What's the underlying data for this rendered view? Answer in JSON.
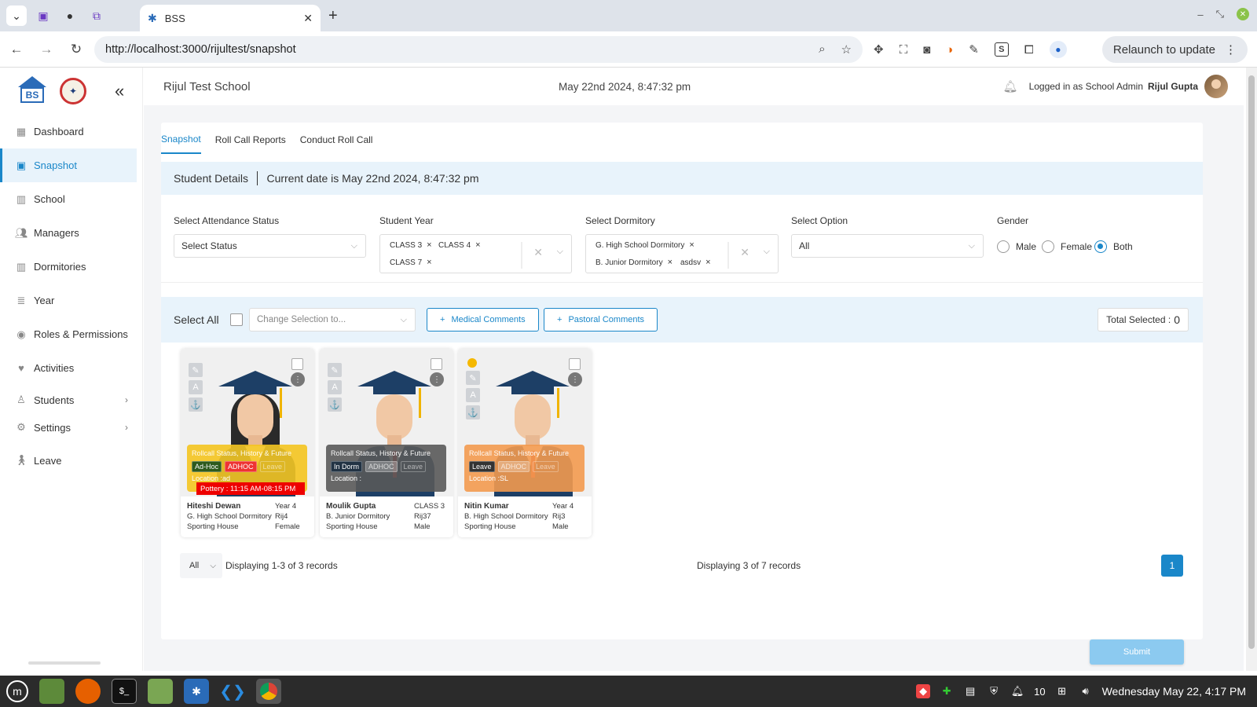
{
  "browser": {
    "tab_title": "BSS",
    "url": "http://localhost:3000/rijultest/snapshot",
    "relaunch_label": "Relaunch to update"
  },
  "sidebar": {
    "items": [
      {
        "label": "Dashboard",
        "icon": "dashboard-icon"
      },
      {
        "label": "Snapshot",
        "icon": "image-icon"
      },
      {
        "label": "School",
        "icon": "building-icon"
      },
      {
        "label": "Managers",
        "icon": "users-icon"
      },
      {
        "label": "Dormitories",
        "icon": "building-icon"
      },
      {
        "label": "Year",
        "icon": "user-list-icon"
      },
      {
        "label": "Roles & Permissions",
        "icon": "user-circle-icon"
      },
      {
        "label": "Activities",
        "icon": "heart-pulse-icon"
      },
      {
        "label": "Students",
        "icon": "user-icon"
      },
      {
        "label": "Settings",
        "icon": "gear-icon"
      },
      {
        "label": "Leave",
        "icon": "walking-icon"
      }
    ],
    "active": "Snapshot"
  },
  "header": {
    "school_name": "Rijul Test School",
    "datetime": "May 22nd 2024, 8:47:32 pm",
    "logged_in_prefix": "Logged in as School Admin",
    "user_name": "Rijul Gupta"
  },
  "tabs": [
    "Snapshot",
    "Roll Call Reports",
    "Conduct Roll Call"
  ],
  "details_bar": {
    "title": "Student Details",
    "current_date": "Current date is May 22nd 2024, 8:47:32 pm"
  },
  "filters": {
    "attendance_label": "Select Attendance Status",
    "attendance_value": "Select Status",
    "year_label": "Student Year",
    "year_chips": [
      "CLASS 3",
      "CLASS 4",
      "CLASS 7"
    ],
    "dorm_label": "Select Dormitory",
    "dorm_chips": [
      "G. High School Dormitory",
      "B. Junior Dormitory",
      "asdsv"
    ],
    "option_label": "Select Option",
    "option_value": "All",
    "gender_label": "Gender",
    "gender_options": [
      "Male",
      "Female",
      "Both"
    ],
    "gender_selected": "Both"
  },
  "actions": {
    "select_all": "Select All",
    "change_selection_placeholder": "Change Selection to...",
    "medical": "Medical Comments",
    "pastoral": "Pastoral Comments",
    "total_label": "Total Selected :",
    "total_value": "0"
  },
  "students": [
    {
      "name": "Hiteshi Dewan",
      "year": "Year 4",
      "dorm": "G. High School Dormitory",
      "code": "Rij4",
      "house": "Sporting House",
      "gender": "Female",
      "panel_title": "Rollcall Status, History & Future",
      "tags": [
        "Ad-Hoc",
        "ADHOC",
        "Leave"
      ],
      "location": "Location :ad",
      "activity": "Pottery : 11:15 AM-08:15 PM",
      "panel_color": "#f4c41f"
    },
    {
      "name": "Moulik Gupta",
      "year": "CLASS 3",
      "dorm": "B. Junior Dormitory",
      "code": "Rij37",
      "house": "Sporting House",
      "gender": "Male",
      "panel_title": "Rollcall Status, History & Future",
      "tags": [
        "In Dorm",
        "ADHOC",
        "Leave"
      ],
      "location": "Location :",
      "panel_color": "#595959"
    },
    {
      "name": "Nitin Kumar",
      "year": "Year 4",
      "dorm": "B. High School Dormitory",
      "code": "Rij3",
      "house": "Sporting House",
      "gender": "Male",
      "panel_title": "Rollcall Status, History & Future",
      "tags": [
        "Leave",
        "ADHOC",
        "Leave"
      ],
      "location": "Location :SL",
      "panel_color": "#f39a4f"
    }
  ],
  "pagination": {
    "page_size": "All",
    "displaying_left": "Displaying 1-3 of 3 records",
    "displaying_center": "Displaying 3 of 7 records",
    "current_page": "1"
  },
  "submit_label": "Submit",
  "taskbar": {
    "clock": "Wednesday May 22, 4:17 PM",
    "tray_count": "10"
  },
  "colors": {
    "accent": "#1a87c9",
    "active_bg": "#e8f3fb"
  }
}
